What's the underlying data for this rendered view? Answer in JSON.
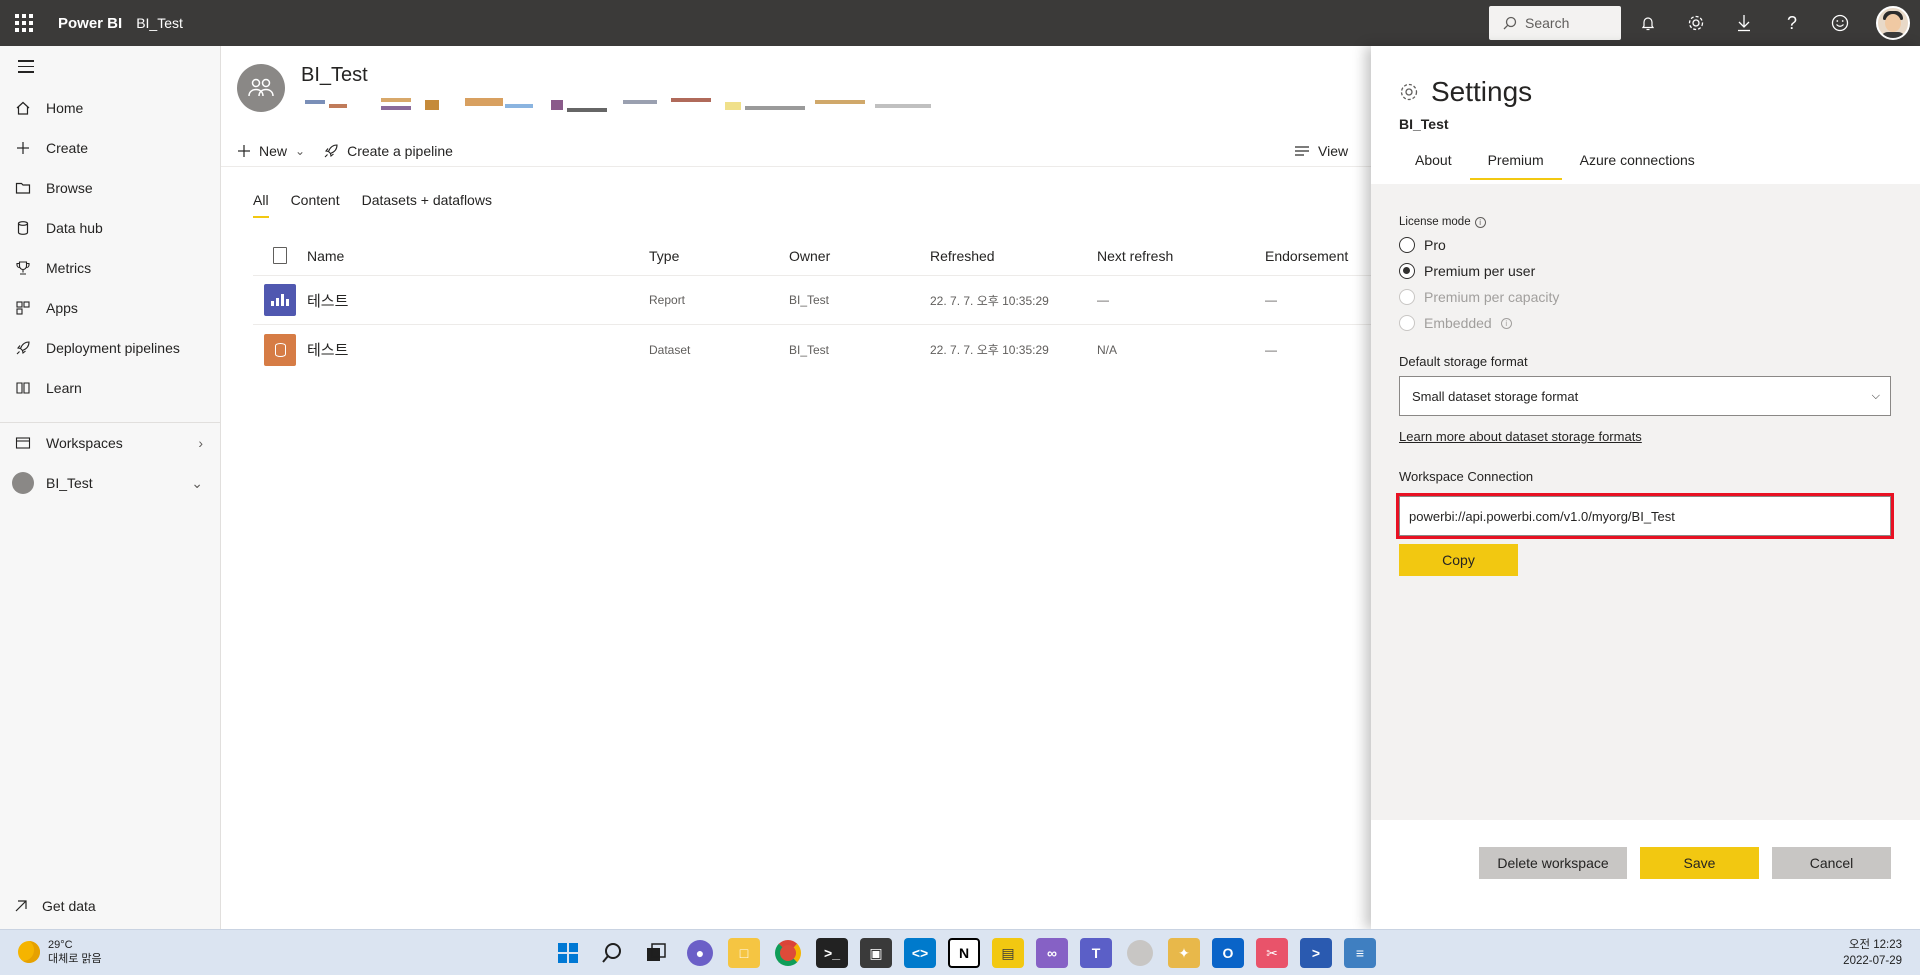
{
  "topbar": {
    "brand": "Power BI",
    "breadcrumb": "BI_Test",
    "search_placeholder": "Search"
  },
  "leftnav": {
    "items": [
      {
        "label": "Home",
        "icon": "home-icon"
      },
      {
        "label": "Create",
        "icon": "plus-icon"
      },
      {
        "label": "Browse",
        "icon": "folder-icon"
      },
      {
        "label": "Data hub",
        "icon": "cylinder-icon"
      },
      {
        "label": "Metrics",
        "icon": "trophy-icon"
      },
      {
        "label": "Apps",
        "icon": "apps-grid-icon"
      },
      {
        "label": "Deployment pipelines",
        "icon": "rocket-icon"
      },
      {
        "label": "Learn",
        "icon": "book-icon"
      }
    ],
    "workspaces_label": "Workspaces",
    "current_workspace": "BI_Test",
    "get_data": "Get data"
  },
  "main": {
    "workspace_title": "BI_Test",
    "toolbar": {
      "new_label": "New",
      "pipeline_label": "Create a pipeline",
      "view_label": "View"
    },
    "tabs": [
      "All",
      "Content",
      "Datasets + dataflows"
    ],
    "table": {
      "headers": [
        "Name",
        "Type",
        "Owner",
        "Refreshed",
        "Next refresh",
        "Endorsement"
      ],
      "rows": [
        {
          "name": "테스트",
          "type": "Report",
          "owner": "BI_Test",
          "refreshed": "22. 7. 7. 오후 10:35:29",
          "next": "—",
          "endorsement": "—"
        },
        {
          "name": "테스트",
          "type": "Dataset",
          "owner": "BI_Test",
          "refreshed": "22. 7. 7. 오후 10:35:29",
          "next": "N/A",
          "endorsement": "—"
        }
      ]
    }
  },
  "settings": {
    "title": "Settings",
    "workspace": "BI_Test",
    "tabs": [
      "About",
      "Premium",
      "Azure connections"
    ],
    "active_tab": "Premium",
    "license_label": "License mode",
    "license_options": [
      {
        "label": "Pro",
        "state": "unchecked"
      },
      {
        "label": "Premium per user",
        "state": "checked"
      },
      {
        "label": "Premium per capacity",
        "state": "disabled"
      },
      {
        "label": "Embedded",
        "state": "disabled"
      }
    ],
    "storage_label": "Default storage format",
    "storage_value": "Small dataset storage format",
    "learn_link": "Learn more about dataset storage formats",
    "connection_label": "Workspace Connection",
    "connection_value": "powerbi://api.powerbi.com/v1.0/myorg/BI_Test",
    "copy_button": "Copy",
    "delete_button": "Delete workspace",
    "save_button": "Save",
    "cancel_button": "Cancel"
  },
  "taskbar": {
    "temperature": "29°C",
    "weather_text": "대체로 맑음",
    "time": "오전 12:23",
    "date": "2022-07-29"
  },
  "colors": {
    "accent_yellow": "#f2c811",
    "topbar": "#3b3a39",
    "highlight_red": "#e81123",
    "report_icon": "#5058b0",
    "dataset_icon": "#d67c45"
  }
}
